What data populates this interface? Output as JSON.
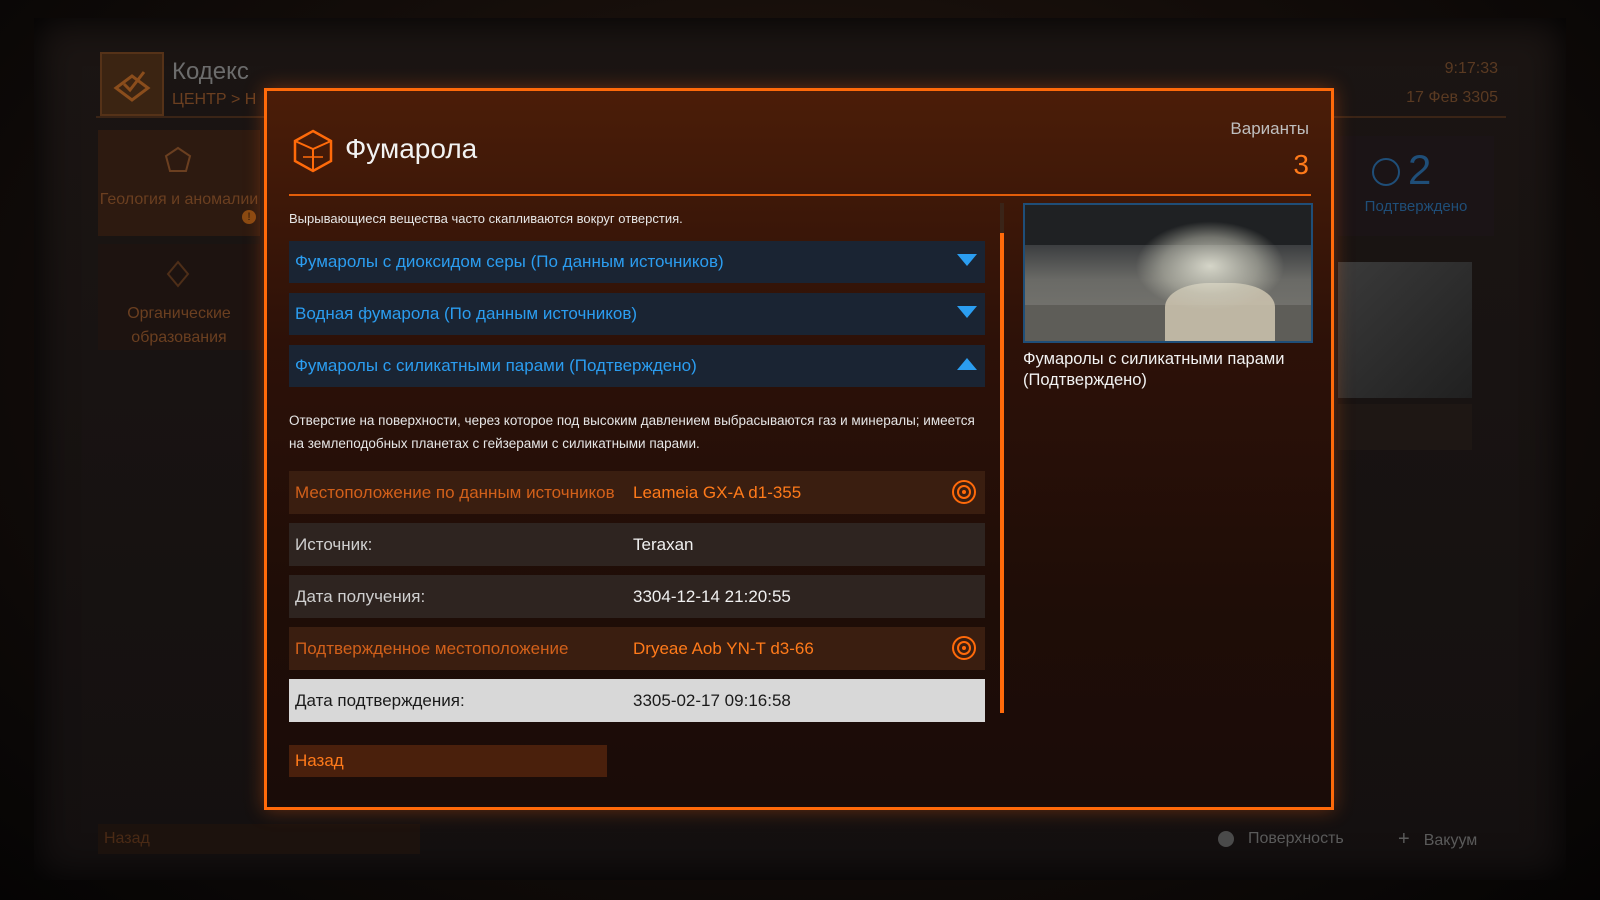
{
  "background": {
    "title": "Кодекс",
    "breadcrumb": "ЦЕНТР > Н",
    "time": "9:17:33",
    "date": "17 Фев 3305",
    "sidebar": [
      {
        "label": "Геология и аномалии"
      },
      {
        "label": "Органические образования"
      }
    ],
    "warning_mark": "!",
    "confirmed_count": "2",
    "confirmed_label": "Подтверждено",
    "back_label": "Назад",
    "footer": [
      {
        "label": "Поверхность",
        "icon": "globe-icon"
      },
      {
        "label": "Вакуум",
        "icon": "plus-icon"
      }
    ]
  },
  "dialog": {
    "title": "Фумарола",
    "variants_label": "Варианты",
    "variants_count": "3",
    "description": "Вырывающиеся вещества часто скапливаются вокруг отверстия.",
    "variants": [
      {
        "label": "Фумаролы с диоксидом серы (По данным источников)",
        "expanded": false
      },
      {
        "label": "Водная фумарола (По данным источников)",
        "expanded": false
      },
      {
        "label": "Фумаролы с силикатными парами (Подтверждено)",
        "expanded": true
      }
    ],
    "variant_body": "Отверстие на поверхности, через которое под высоким давлением выбрасываются газ и минералы; имеется на землеподобных планетах с гейзерами с силикатными парами.",
    "details": [
      {
        "key": "Местоположение по данным источников",
        "value": "Leameia GX-A d1-355"
      },
      {
        "key": "Источник:",
        "value": "Teraxan"
      },
      {
        "key": "Дата получения:",
        "value": "3304-12-14 21:20:55"
      },
      {
        "key": "Подтвержденное местоположение",
        "value": "Dryeae Aob YN-T d3-66"
      },
      {
        "key": "Дата подтверждения:",
        "value": "3305-02-17 09:16:58"
      }
    ],
    "preview_caption": "Фумаролы с силикатными парами (Подтверждено)",
    "back_label": "Назад"
  },
  "colors": {
    "accent_orange": "#ff6a0a",
    "link_blue": "#2b9df0"
  }
}
